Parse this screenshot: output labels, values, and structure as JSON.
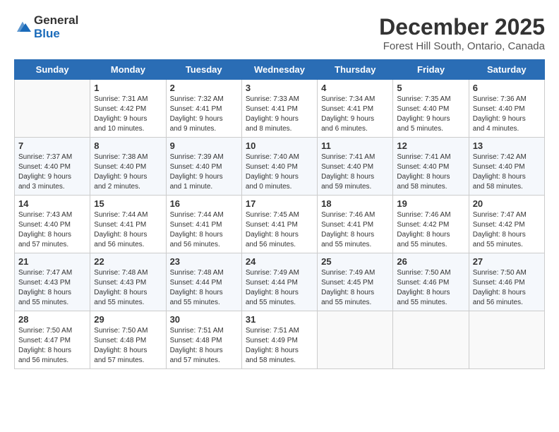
{
  "logo": {
    "text_general": "General",
    "text_blue": "Blue"
  },
  "title": "December 2025",
  "subtitle": "Forest Hill South, Ontario, Canada",
  "days_of_week": [
    "Sunday",
    "Monday",
    "Tuesday",
    "Wednesday",
    "Thursday",
    "Friday",
    "Saturday"
  ],
  "weeks": [
    [
      {
        "day": "",
        "info": ""
      },
      {
        "day": "1",
        "info": "Sunrise: 7:31 AM\nSunset: 4:42 PM\nDaylight: 9 hours\nand 10 minutes."
      },
      {
        "day": "2",
        "info": "Sunrise: 7:32 AM\nSunset: 4:41 PM\nDaylight: 9 hours\nand 9 minutes."
      },
      {
        "day": "3",
        "info": "Sunrise: 7:33 AM\nSunset: 4:41 PM\nDaylight: 9 hours\nand 8 minutes."
      },
      {
        "day": "4",
        "info": "Sunrise: 7:34 AM\nSunset: 4:41 PM\nDaylight: 9 hours\nand 6 minutes."
      },
      {
        "day": "5",
        "info": "Sunrise: 7:35 AM\nSunset: 4:40 PM\nDaylight: 9 hours\nand 5 minutes."
      },
      {
        "day": "6",
        "info": "Sunrise: 7:36 AM\nSunset: 4:40 PM\nDaylight: 9 hours\nand 4 minutes."
      }
    ],
    [
      {
        "day": "7",
        "info": "Sunrise: 7:37 AM\nSunset: 4:40 PM\nDaylight: 9 hours\nand 3 minutes."
      },
      {
        "day": "8",
        "info": "Sunrise: 7:38 AM\nSunset: 4:40 PM\nDaylight: 9 hours\nand 2 minutes."
      },
      {
        "day": "9",
        "info": "Sunrise: 7:39 AM\nSunset: 4:40 PM\nDaylight: 9 hours\nand 1 minute."
      },
      {
        "day": "10",
        "info": "Sunrise: 7:40 AM\nSunset: 4:40 PM\nDaylight: 9 hours\nand 0 minutes."
      },
      {
        "day": "11",
        "info": "Sunrise: 7:41 AM\nSunset: 4:40 PM\nDaylight: 8 hours\nand 59 minutes."
      },
      {
        "day": "12",
        "info": "Sunrise: 7:41 AM\nSunset: 4:40 PM\nDaylight: 8 hours\nand 58 minutes."
      },
      {
        "day": "13",
        "info": "Sunrise: 7:42 AM\nSunset: 4:40 PM\nDaylight: 8 hours\nand 58 minutes."
      }
    ],
    [
      {
        "day": "14",
        "info": "Sunrise: 7:43 AM\nSunset: 4:40 PM\nDaylight: 8 hours\nand 57 minutes."
      },
      {
        "day": "15",
        "info": "Sunrise: 7:44 AM\nSunset: 4:41 PM\nDaylight: 8 hours\nand 56 minutes."
      },
      {
        "day": "16",
        "info": "Sunrise: 7:44 AM\nSunset: 4:41 PM\nDaylight: 8 hours\nand 56 minutes."
      },
      {
        "day": "17",
        "info": "Sunrise: 7:45 AM\nSunset: 4:41 PM\nDaylight: 8 hours\nand 56 minutes."
      },
      {
        "day": "18",
        "info": "Sunrise: 7:46 AM\nSunset: 4:41 PM\nDaylight: 8 hours\nand 55 minutes."
      },
      {
        "day": "19",
        "info": "Sunrise: 7:46 AM\nSunset: 4:42 PM\nDaylight: 8 hours\nand 55 minutes."
      },
      {
        "day": "20",
        "info": "Sunrise: 7:47 AM\nSunset: 4:42 PM\nDaylight: 8 hours\nand 55 minutes."
      }
    ],
    [
      {
        "day": "21",
        "info": "Sunrise: 7:47 AM\nSunset: 4:43 PM\nDaylight: 8 hours\nand 55 minutes."
      },
      {
        "day": "22",
        "info": "Sunrise: 7:48 AM\nSunset: 4:43 PM\nDaylight: 8 hours\nand 55 minutes."
      },
      {
        "day": "23",
        "info": "Sunrise: 7:48 AM\nSunset: 4:44 PM\nDaylight: 8 hours\nand 55 minutes."
      },
      {
        "day": "24",
        "info": "Sunrise: 7:49 AM\nSunset: 4:44 PM\nDaylight: 8 hours\nand 55 minutes."
      },
      {
        "day": "25",
        "info": "Sunrise: 7:49 AM\nSunset: 4:45 PM\nDaylight: 8 hours\nand 55 minutes."
      },
      {
        "day": "26",
        "info": "Sunrise: 7:50 AM\nSunset: 4:46 PM\nDaylight: 8 hours\nand 55 minutes."
      },
      {
        "day": "27",
        "info": "Sunrise: 7:50 AM\nSunset: 4:46 PM\nDaylight: 8 hours\nand 56 minutes."
      }
    ],
    [
      {
        "day": "28",
        "info": "Sunrise: 7:50 AM\nSunset: 4:47 PM\nDaylight: 8 hours\nand 56 minutes."
      },
      {
        "day": "29",
        "info": "Sunrise: 7:50 AM\nSunset: 4:48 PM\nDaylight: 8 hours\nand 57 minutes."
      },
      {
        "day": "30",
        "info": "Sunrise: 7:51 AM\nSunset: 4:48 PM\nDaylight: 8 hours\nand 57 minutes."
      },
      {
        "day": "31",
        "info": "Sunrise: 7:51 AM\nSunset: 4:49 PM\nDaylight: 8 hours\nand 58 minutes."
      },
      {
        "day": "",
        "info": ""
      },
      {
        "day": "",
        "info": ""
      },
      {
        "day": "",
        "info": ""
      }
    ]
  ]
}
